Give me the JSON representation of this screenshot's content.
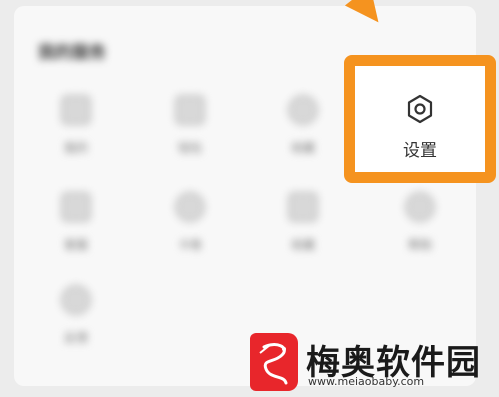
{
  "colors": {
    "accent": "#f5931f",
    "brand_red": "#e8262b"
  },
  "services_section": {
    "title": "我的服务",
    "items": [
      {
        "label": "我的",
        "icon": "phone-icon"
      },
      {
        "label": "钱包",
        "icon": "wallet-icon"
      },
      {
        "label": "收藏",
        "icon": "star-icon"
      },
      {
        "label": "客服",
        "icon": "headset-icon"
      },
      {
        "label": "卡卷",
        "icon": "ticket-icon"
      },
      {
        "label": "收藏",
        "icon": "bookmark-icon"
      },
      {
        "label": "帮助",
        "icon": "help-icon"
      },
      {
        "label": "反馈",
        "icon": "feedback-icon"
      }
    ]
  },
  "settings": {
    "label": "设置",
    "icon": "gear-icon"
  },
  "watermark": {
    "title": "梅奥软件园",
    "url": "www.meiaobaby.com"
  }
}
